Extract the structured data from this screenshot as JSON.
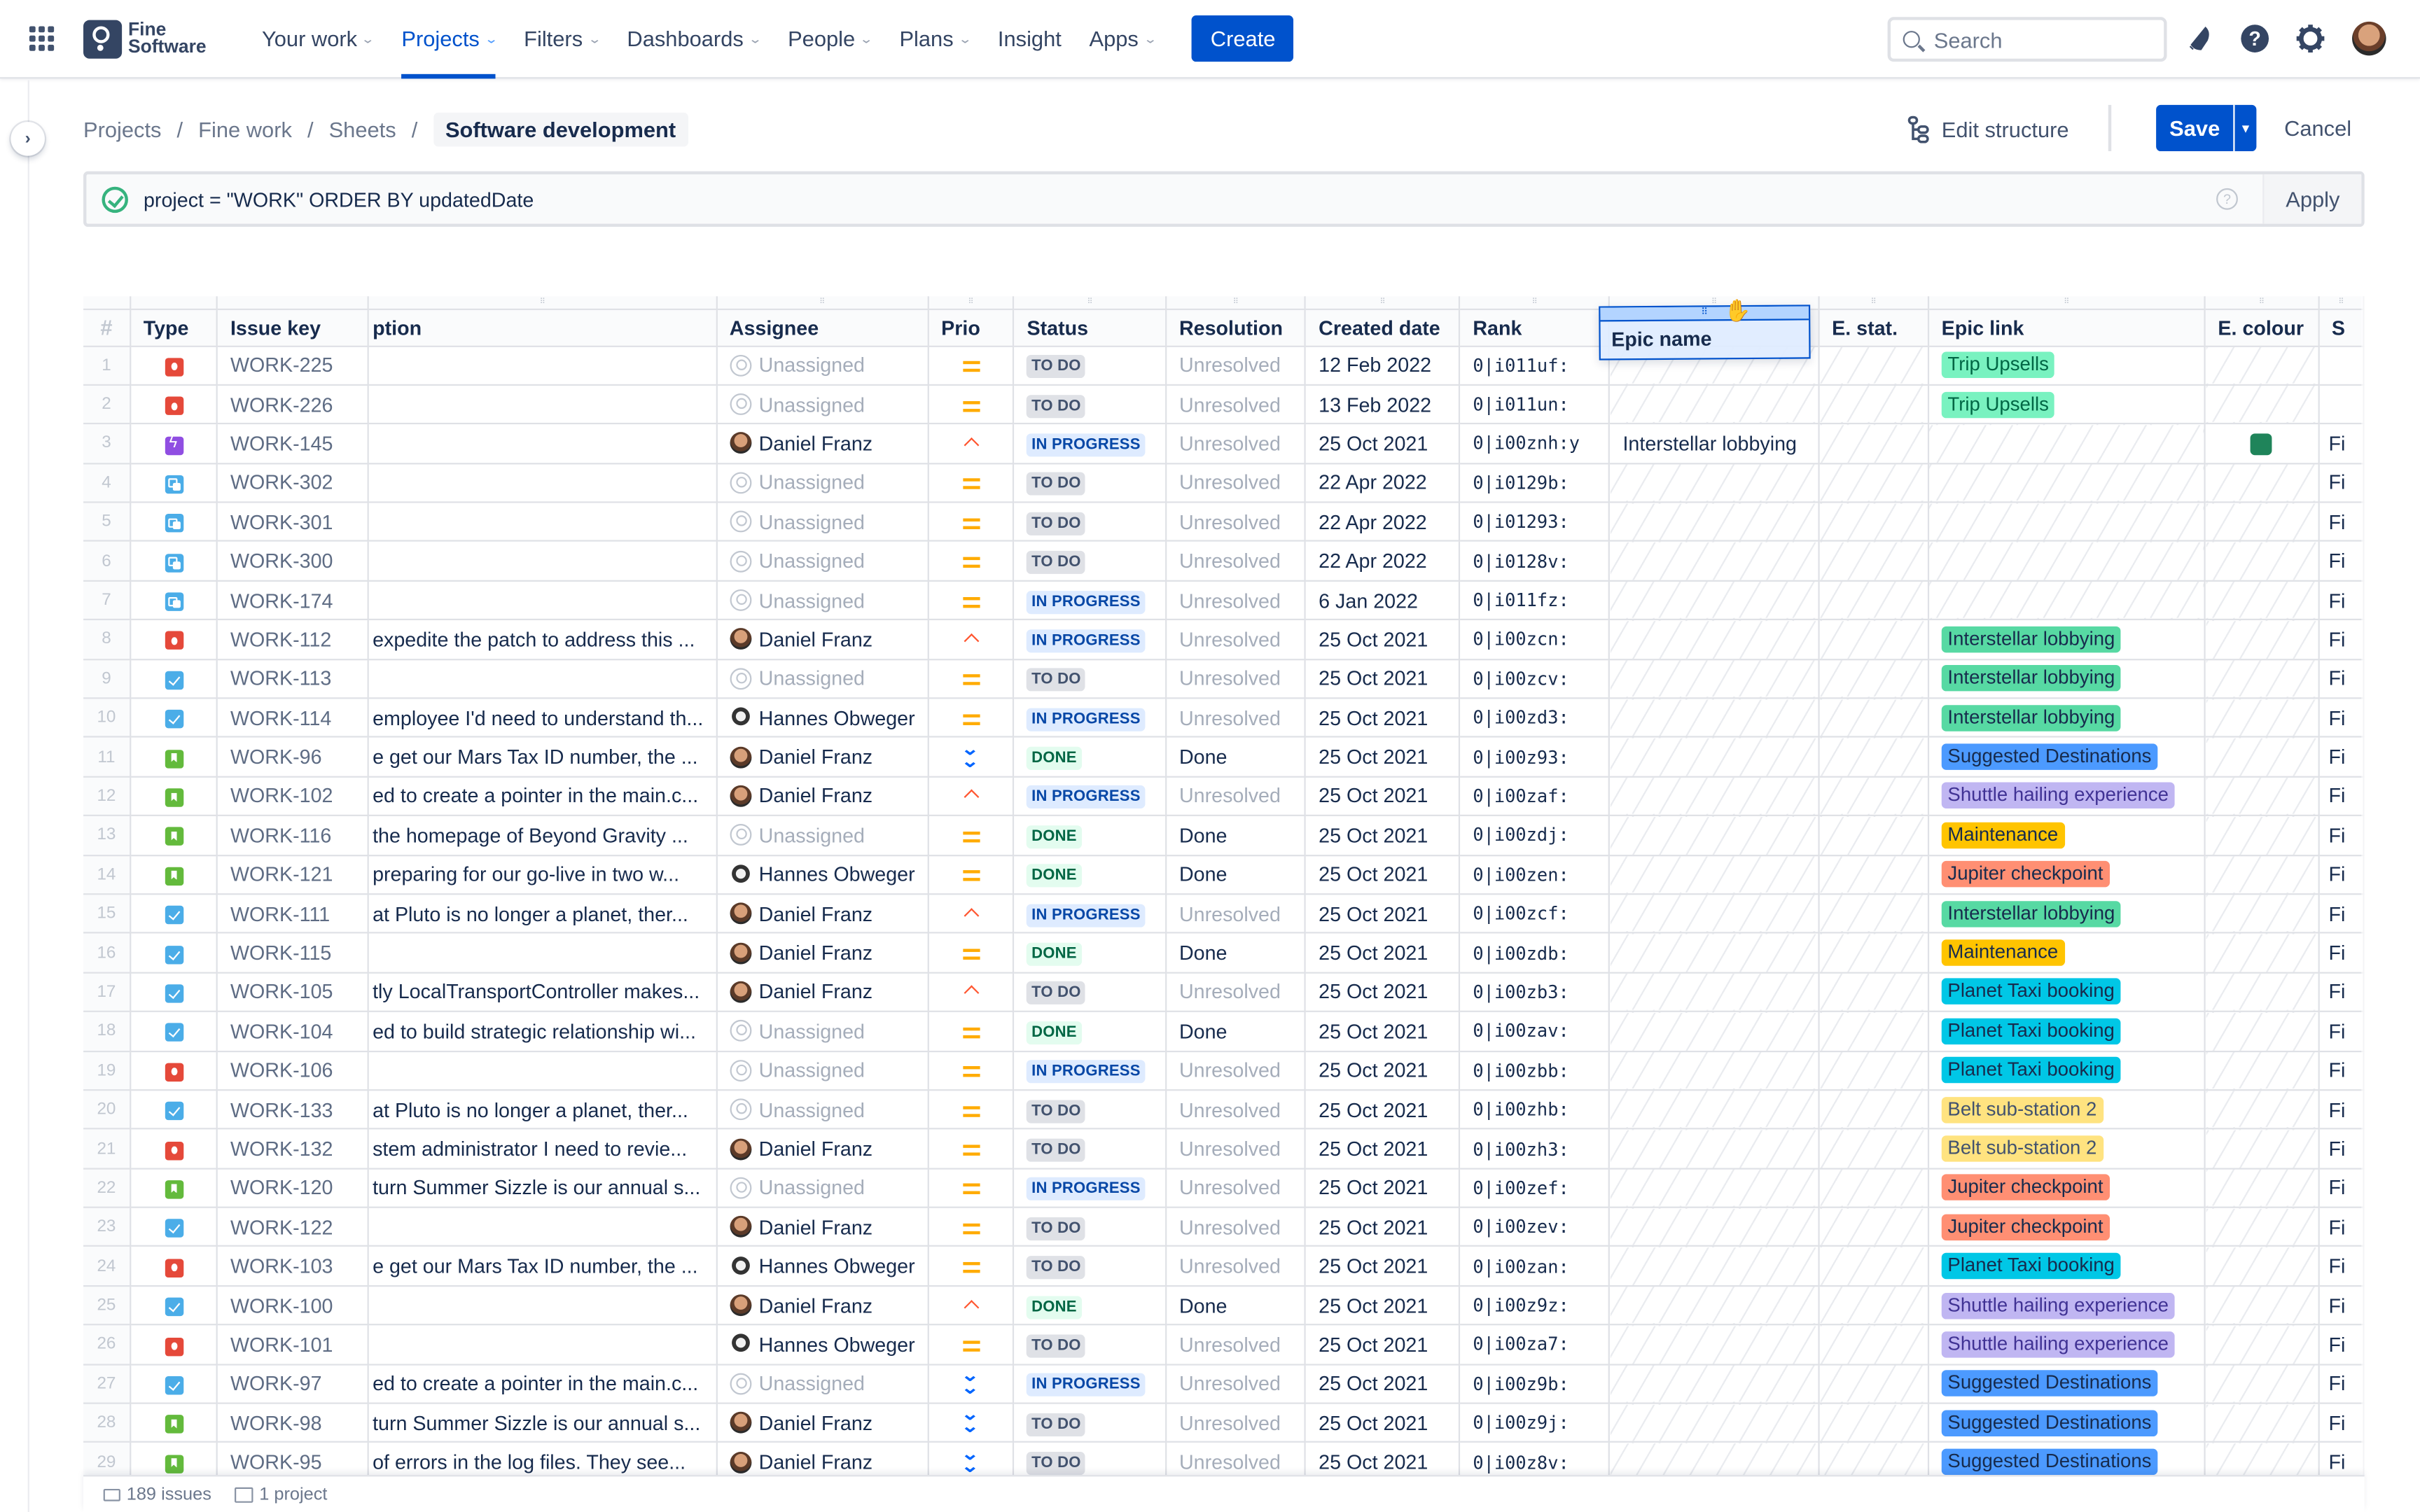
{
  "nav": {
    "logo_line1": "Fine",
    "logo_line2": "Software",
    "items": [
      {
        "label": "Your work",
        "dropdown": true,
        "active": false
      },
      {
        "label": "Projects",
        "dropdown": true,
        "active": true
      },
      {
        "label": "Filters",
        "dropdown": true,
        "active": false
      },
      {
        "label": "Dashboards",
        "dropdown": true,
        "active": false
      },
      {
        "label": "People",
        "dropdown": true,
        "active": false
      },
      {
        "label": "Plans",
        "dropdown": true,
        "active": false
      },
      {
        "label": "Insight",
        "dropdown": false,
        "active": false
      },
      {
        "label": "Apps",
        "dropdown": true,
        "active": false
      }
    ],
    "create_label": "Create",
    "search_placeholder": "Search"
  },
  "breadcrumbs": [
    "Projects",
    "Fine work",
    "Sheets"
  ],
  "page_title": "Software development",
  "actions": {
    "edit_structure": "Edit structure",
    "save": "Save",
    "cancel": "Cancel"
  },
  "jql": {
    "query": "project = \"WORK\" ORDER BY updatedDate",
    "help": "?",
    "apply": "Apply"
  },
  "table": {
    "columns": [
      "#",
      "Type",
      "Issue key",
      "ption",
      "Assignee",
      "Prio",
      "Status",
      "Resolution",
      "Created date",
      "Rank",
      "",
      "E. stat.",
      "Epic link",
      "E. colour",
      "S"
    ],
    "dragging_column": "Epic name",
    "epic_colors": {
      "Trip Upsells": {
        "bg": "#79f2c0",
        "fg": "#006644"
      },
      "Interstellar lobbying": {
        "bg": "#57d9a3",
        "fg": "#172b4d"
      },
      "Suggested Destinations": {
        "bg": "#4c9aff",
        "fg": "#172b4d"
      },
      "Shuttle hailing experience": {
        "bg": "#c0b6f2",
        "fg": "#403294"
      },
      "Maintenance": {
        "bg": "#ffc400",
        "fg": "#172b4d"
      },
      "Jupiter checkpoint": {
        "bg": "#ff8f73",
        "fg": "#172b4d"
      },
      "Planet Taxi booking": {
        "bg": "#00c7e6",
        "fg": "#172b4d"
      },
      "Belt sub-station 2": {
        "bg": "#ffe380",
        "fg": "#42526e"
      }
    },
    "rows": [
      {
        "n": "1",
        "type": "bug",
        "key": "WORK-225",
        "desc": "",
        "assignee": "Unassigned",
        "prio": "medium",
        "status": "TO DO",
        "resolution": "Unresolved",
        "created": "12 Feb 2022",
        "rank": "0|i011uf:",
        "epic_name": "",
        "epic_link": "Trip Upsells",
        "e_colour": "",
        "s": ""
      },
      {
        "n": "2",
        "type": "bug",
        "key": "WORK-226",
        "desc": "",
        "assignee": "Unassigned",
        "prio": "medium",
        "status": "TO DO",
        "resolution": "Unresolved",
        "created": "13 Feb 2022",
        "rank": "0|i011un:",
        "epic_name": "",
        "epic_link": "Trip Upsells",
        "e_colour": "",
        "s": ""
      },
      {
        "n": "3",
        "type": "epic",
        "key": "WORK-145",
        "desc": "",
        "assignee": "Daniel Franz",
        "prio": "high",
        "status": "IN PROGRESS",
        "resolution": "Unresolved",
        "created": "25 Oct 2021",
        "rank": "0|i00znh:y",
        "epic_name": "Interstellar lobbying",
        "epic_link": "",
        "e_colour": "#1f845a",
        "s": "Fi"
      },
      {
        "n": "4",
        "type": "subtask",
        "key": "WORK-302",
        "desc": "",
        "assignee": "Unassigned",
        "prio": "medium",
        "status": "TO DO",
        "resolution": "Unresolved",
        "created": "22 Apr 2022",
        "rank": "0|i0129b:",
        "epic_name": "",
        "epic_link": "",
        "e_colour": "",
        "s": "Fi"
      },
      {
        "n": "5",
        "type": "subtask",
        "key": "WORK-301",
        "desc": "",
        "assignee": "Unassigned",
        "prio": "medium",
        "status": "TO DO",
        "resolution": "Unresolved",
        "created": "22 Apr 2022",
        "rank": "0|i01293:",
        "epic_name": "",
        "epic_link": "",
        "e_colour": "",
        "s": "Fi"
      },
      {
        "n": "6",
        "type": "subtask",
        "key": "WORK-300",
        "desc": "",
        "assignee": "Unassigned",
        "prio": "medium",
        "status": "TO DO",
        "resolution": "Unresolved",
        "created": "22 Apr 2022",
        "rank": "0|i0128v:",
        "epic_name": "",
        "epic_link": "",
        "e_colour": "",
        "s": "Fi"
      },
      {
        "n": "7",
        "type": "subtask",
        "key": "WORK-174",
        "desc": "",
        "assignee": "Unassigned",
        "prio": "medium",
        "status": "IN PROGRESS",
        "resolution": "Unresolved",
        "created": "6 Jan 2022",
        "rank": "0|i011fz:",
        "epic_name": "",
        "epic_link": "",
        "e_colour": "",
        "s": "Fi"
      },
      {
        "n": "8",
        "type": "bug",
        "key": "WORK-112",
        "desc": "expedite the patch to address this ...",
        "assignee": "Daniel Franz",
        "prio": "high",
        "status": "IN PROGRESS",
        "resolution": "Unresolved",
        "created": "25 Oct 2021",
        "rank": "0|i00zcn:",
        "epic_name": "",
        "epic_link": "Interstellar lobbying",
        "e_colour": "",
        "s": "Fi"
      },
      {
        "n": "9",
        "type": "task",
        "key": "WORK-113",
        "desc": "",
        "assignee": "Unassigned",
        "prio": "medium",
        "status": "TO DO",
        "resolution": "Unresolved",
        "created": "25 Oct 2021",
        "rank": "0|i00zcv:",
        "epic_name": "",
        "epic_link": "Interstellar lobbying",
        "e_colour": "",
        "s": "Fi"
      },
      {
        "n": "10",
        "type": "task",
        "key": "WORK-114",
        "desc": "employee I'd need to understand th...",
        "assignee": "Hannes Obweger",
        "prio": "medium",
        "status": "IN PROGRESS",
        "resolution": "Unresolved",
        "created": "25 Oct 2021",
        "rank": "0|i00zd3:",
        "epic_name": "",
        "epic_link": "Interstellar lobbying",
        "e_colour": "",
        "s": "Fi"
      },
      {
        "n": "11",
        "type": "story",
        "key": "WORK-96",
        "desc": "e get our Mars Tax ID number, the ...",
        "assignee": "Daniel Franz",
        "prio": "lowest",
        "status": "DONE",
        "resolution": "Done",
        "created": "25 Oct 2021",
        "rank": "0|i00z93:",
        "epic_name": "",
        "epic_link": "Suggested Destinations",
        "e_colour": "",
        "s": "Fi"
      },
      {
        "n": "12",
        "type": "story",
        "key": "WORK-102",
        "desc": "ed to create a pointer in the main.c...",
        "assignee": "Daniel Franz",
        "prio": "high",
        "status": "IN PROGRESS",
        "resolution": "Unresolved",
        "created": "25 Oct 2021",
        "rank": "0|i00zaf:",
        "epic_name": "",
        "epic_link": "Shuttle hailing experience",
        "e_colour": "",
        "s": "Fi"
      },
      {
        "n": "13",
        "type": "story",
        "key": "WORK-116",
        "desc": "the homepage of Beyond Gravity ...",
        "assignee": "Unassigned",
        "prio": "medium",
        "status": "DONE",
        "resolution": "Done",
        "created": "25 Oct 2021",
        "rank": "0|i00zdj:",
        "epic_name": "",
        "epic_link": "Maintenance",
        "e_colour": "",
        "s": "Fi"
      },
      {
        "n": "14",
        "type": "story",
        "key": "WORK-121",
        "desc": "preparing for our go-live in two w...",
        "assignee": "Hannes Obweger",
        "prio": "medium",
        "status": "DONE",
        "resolution": "Done",
        "created": "25 Oct 2021",
        "rank": "0|i00zen:",
        "epic_name": "",
        "epic_link": "Jupiter checkpoint",
        "e_colour": "",
        "s": "Fi"
      },
      {
        "n": "15",
        "type": "task",
        "key": "WORK-111",
        "desc": "at Pluto is no longer a planet, ther...",
        "assignee": "Daniel Franz",
        "prio": "high",
        "status": "IN PROGRESS",
        "resolution": "Unresolved",
        "created": "25 Oct 2021",
        "rank": "0|i00zcf:",
        "epic_name": "",
        "epic_link": "Interstellar lobbying",
        "e_colour": "",
        "s": "Fi"
      },
      {
        "n": "16",
        "type": "task",
        "key": "WORK-115",
        "desc": "",
        "assignee": "Daniel Franz",
        "prio": "medium",
        "status": "DONE",
        "resolution": "Done",
        "created": "25 Oct 2021",
        "rank": "0|i00zdb:",
        "epic_name": "",
        "epic_link": "Maintenance",
        "e_colour": "",
        "s": "Fi"
      },
      {
        "n": "17",
        "type": "task",
        "key": "WORK-105",
        "desc": "tly LocalTransportController makes...",
        "assignee": "Daniel Franz",
        "prio": "high",
        "status": "TO DO",
        "resolution": "Unresolved",
        "created": "25 Oct 2021",
        "rank": "0|i00zb3:",
        "epic_name": "",
        "epic_link": "Planet Taxi booking",
        "e_colour": "",
        "s": "Fi"
      },
      {
        "n": "18",
        "type": "task",
        "key": "WORK-104",
        "desc": "ed to build strategic relationship wi...",
        "assignee": "Unassigned",
        "prio": "medium",
        "status": "DONE",
        "resolution": "Done",
        "created": "25 Oct 2021",
        "rank": "0|i00zav:",
        "epic_name": "",
        "epic_link": "Planet Taxi booking",
        "e_colour": "",
        "s": "Fi"
      },
      {
        "n": "19",
        "type": "bug",
        "key": "WORK-106",
        "desc": "",
        "assignee": "Unassigned",
        "prio": "medium",
        "status": "IN PROGRESS",
        "resolution": "Unresolved",
        "created": "25 Oct 2021",
        "rank": "0|i00zbb:",
        "epic_name": "",
        "epic_link": "Planet Taxi booking",
        "e_colour": "",
        "s": "Fi"
      },
      {
        "n": "20",
        "type": "task",
        "key": "WORK-133",
        "desc": "at Pluto is no longer a planet, ther...",
        "assignee": "Unassigned",
        "prio": "medium",
        "status": "TO DO",
        "resolution": "Unresolved",
        "created": "25 Oct 2021",
        "rank": "0|i00zhb:",
        "epic_name": "",
        "epic_link": "Belt sub-station 2",
        "e_colour": "",
        "s": "Fi"
      },
      {
        "n": "21",
        "type": "bug",
        "key": "WORK-132",
        "desc": "stem administrator I need to revie...",
        "assignee": "Daniel Franz",
        "prio": "medium",
        "status": "TO DO",
        "resolution": "Unresolved",
        "created": "25 Oct 2021",
        "rank": "0|i00zh3:",
        "epic_name": "",
        "epic_link": "Belt sub-station 2",
        "e_colour": "",
        "s": "Fi"
      },
      {
        "n": "22",
        "type": "story",
        "key": "WORK-120",
        "desc": "turn Summer Sizzle is our annual s...",
        "assignee": "Unassigned",
        "prio": "medium",
        "status": "IN PROGRESS",
        "resolution": "Unresolved",
        "created": "25 Oct 2021",
        "rank": "0|i00zef:",
        "epic_name": "",
        "epic_link": "Jupiter checkpoint",
        "e_colour": "",
        "s": "Fi"
      },
      {
        "n": "23",
        "type": "task",
        "key": "WORK-122",
        "desc": "",
        "assignee": "Daniel Franz",
        "prio": "medium",
        "status": "TO DO",
        "resolution": "Unresolved",
        "created": "25 Oct 2021",
        "rank": "0|i00zev:",
        "epic_name": "",
        "epic_link": "Jupiter checkpoint",
        "e_colour": "",
        "s": "Fi"
      },
      {
        "n": "24",
        "type": "bug",
        "key": "WORK-103",
        "desc": "e get our Mars Tax ID number, the ...",
        "assignee": "Hannes Obweger",
        "prio": "medium",
        "status": "TO DO",
        "resolution": "Unresolved",
        "created": "25 Oct 2021",
        "rank": "0|i00zan:",
        "epic_name": "",
        "epic_link": "Planet Taxi booking",
        "e_colour": "",
        "s": "Fi"
      },
      {
        "n": "25",
        "type": "task",
        "key": "WORK-100",
        "desc": "",
        "assignee": "Daniel Franz",
        "prio": "high",
        "status": "DONE",
        "resolution": "Done",
        "created": "25 Oct 2021",
        "rank": "0|i00z9z:",
        "epic_name": "",
        "epic_link": "Shuttle hailing experience",
        "e_colour": "",
        "s": "Fi"
      },
      {
        "n": "26",
        "type": "bug",
        "key": "WORK-101",
        "desc": "",
        "assignee": "Hannes Obweger",
        "prio": "medium",
        "status": "TO DO",
        "resolution": "Unresolved",
        "created": "25 Oct 2021",
        "rank": "0|i00za7:",
        "epic_name": "",
        "epic_link": "Shuttle hailing experience",
        "e_colour": "",
        "s": "Fi"
      },
      {
        "n": "27",
        "type": "task",
        "key": "WORK-97",
        "desc": "ed to create a pointer in the main.c...",
        "assignee": "Unassigned",
        "prio": "lowest",
        "status": "IN PROGRESS",
        "resolution": "Unresolved",
        "created": "25 Oct 2021",
        "rank": "0|i00z9b:",
        "epic_name": "",
        "epic_link": "Suggested Destinations",
        "e_colour": "",
        "s": "Fi"
      },
      {
        "n": "28",
        "type": "story",
        "key": "WORK-98",
        "desc": "turn Summer Sizzle is our annual s...",
        "assignee": "Daniel Franz",
        "prio": "lowest",
        "status": "TO DO",
        "resolution": "Unresolved",
        "created": "25 Oct 2021",
        "rank": "0|i00z9j:",
        "epic_name": "",
        "epic_link": "Suggested Destinations",
        "e_colour": "",
        "s": "Fi"
      },
      {
        "n": "29",
        "type": "story",
        "key": "WORK-95",
        "desc": "of errors in the log files. They see...",
        "assignee": "Daniel Franz",
        "prio": "lowest",
        "status": "TO DO",
        "resolution": "Unresolved",
        "created": "25 Oct 2021",
        "rank": "0|i00z8v:",
        "epic_name": "",
        "epic_link": "Suggested Destinations",
        "e_colour": "",
        "s": "Fi"
      }
    ]
  },
  "footer": {
    "issues": "189 issues",
    "projects": "1 project"
  }
}
